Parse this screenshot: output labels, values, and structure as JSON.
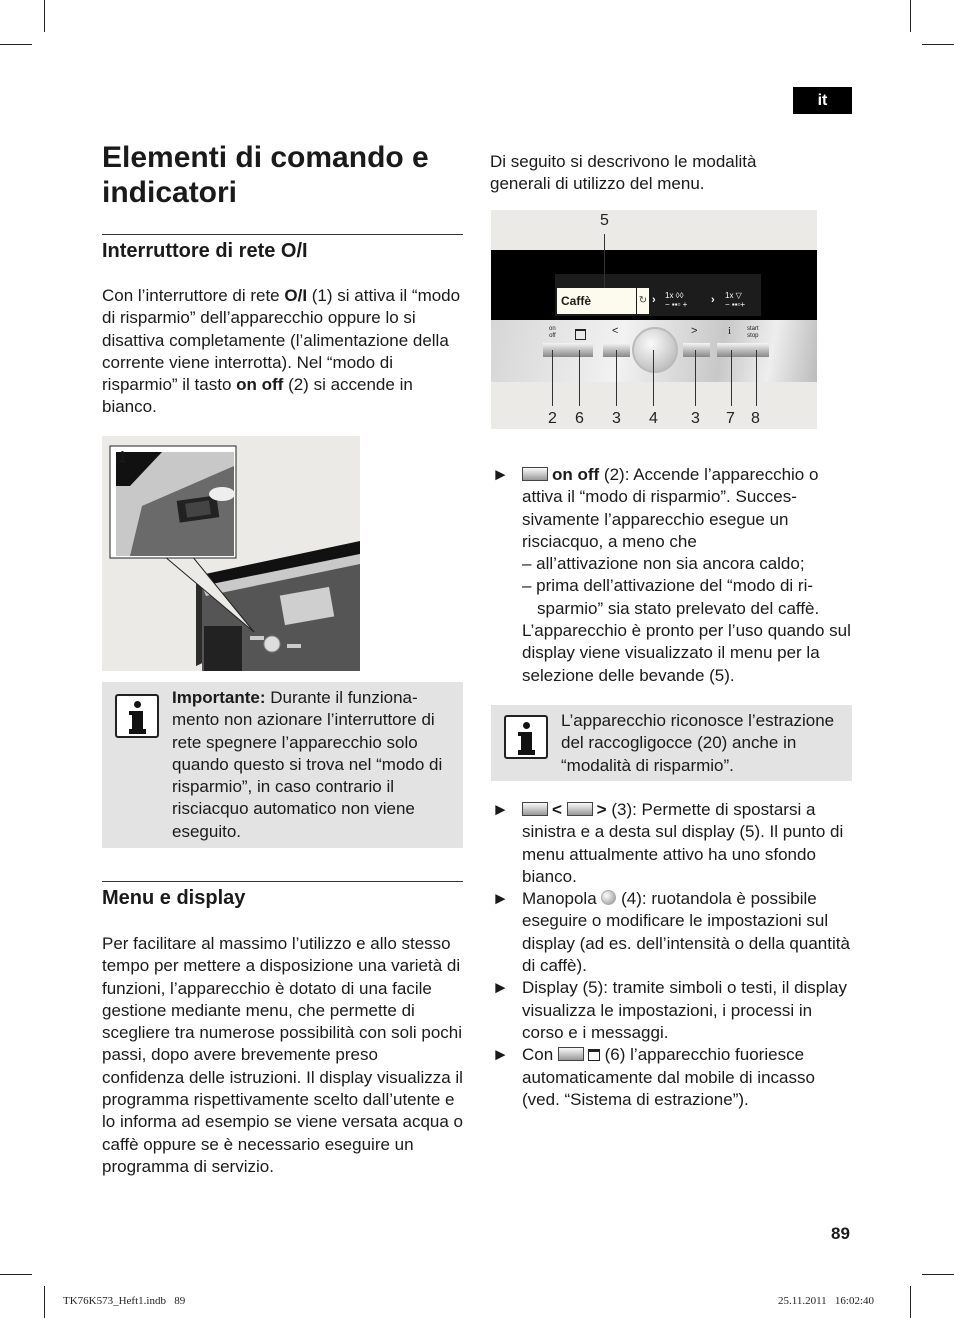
{
  "page": {
    "language_tab": "it",
    "page_number": "89",
    "footer_left": "TK76K573_Heft1.indb   89",
    "footer_right": "25.11.2011   16:02:40"
  },
  "left": {
    "title": "Elementi di comando e indicatori",
    "section1": {
      "heading": "Interruttore di rete O/I",
      "para_parts": [
        "Con l’interruttore di rete ",
        "O/I",
        " (1) si attiva il “modo di risparmio” dell’apparecchio oppure lo si disattiva completamente (l’alimentazione della corrente viene in­terrotta). Nel “modo di risparmio” il tasto ",
        "on off",
        " (2) si accende in bianco."
      ],
      "figure_label": "1"
    },
    "important": {
      "label": "Importante:",
      "text": " Durante il funziona­mento non azionare l’interruttore di rete spegnere l’apparecchio solo quando questo si trova nel “modo di risparmio”, in caso con­trario il risciacquo automatico non viene eseguito."
    },
    "section2": {
      "heading": "Menu e display",
      "para": "Per facilitare al massimo l’utilizzo e allo stesso tempo per mettere a disposizione una varietà di funzioni, l’apparecchio è dotato di una facile gestione mediante menu, che permette di scegliere tra nume­rose possibilità con soli pochi passi, dopo avere brevemente preso confidenza delle istruzioni. Il display visualizza il programma rispettivamente scelto dall’utente e lo infor­ma ad esempio se viene versata acqua o caffè oppure se è necessario eseguire un programma di servizio."
    }
  },
  "right": {
    "intro": "Di seguito si descrivono le modalità generali di utilizzo del menu.",
    "panel": {
      "callout_top": "5",
      "display_text": "Caffè",
      "strength_label": "1x",
      "cups_label": "1x",
      "button_labels": {
        "onoff_1": "on",
        "onoff_2": "off",
        "left": "<",
        "right": ">",
        "info": "i",
        "start_1": "start",
        "start_2": "stop"
      },
      "callouts_bottom": [
        "2",
        "6",
        "3",
        "4",
        "3",
        "7",
        "8"
      ]
    },
    "item_onoff": {
      "bullet": "►",
      "bold": "on off",
      "text": " (2): Accende l’apparecchio o attiva il “modo di risparmio”. Succes­sivamente l’apparecchio esegue un risciacquo, a meno che",
      "dash1": "– all’attivazione non sia ancora caldo;",
      "dash2": "– prima dell’attivazione del “modo di ri­sparmio” sia stato prelevato del caffè.",
      "after": "L’apparecchio è pronto per l’uso quando sul display viene visualizzato il menu per la selezione delle bevande (5)."
    },
    "info_note": "L’apparecchio riconosce l’estrazio­ne del raccogligocce (20) anche in “modalità di risparmio”.",
    "item_arrows": {
      "bullet": "►",
      "lt": "<",
      "gt": ">",
      "text": " (3): Permette di spostarsi a sinistra e a desta sul display (5). Il punto di menu attualmente attivo ha uno sfondo bianco."
    },
    "item_knob": {
      "bullet": "►",
      "pre": "Manopola ",
      "text": " (4): ruotandola è possibile eseguire o modificare le impostazioni sul display (ad es. dell’intensità o della quantità di caffè)."
    },
    "item_display": {
      "bullet": "►",
      "text": "Display (5): tramite simboli o testi, il display visualizza le impostazioni, i processi in corso e i messaggi."
    },
    "item_con": {
      "bullet": "►",
      "pre": "Con ",
      "text": " (6) l’apparecchio fuoriesce automaticamente dal mobile di incasso (ved. “Sistema di estrazione”)."
    }
  }
}
